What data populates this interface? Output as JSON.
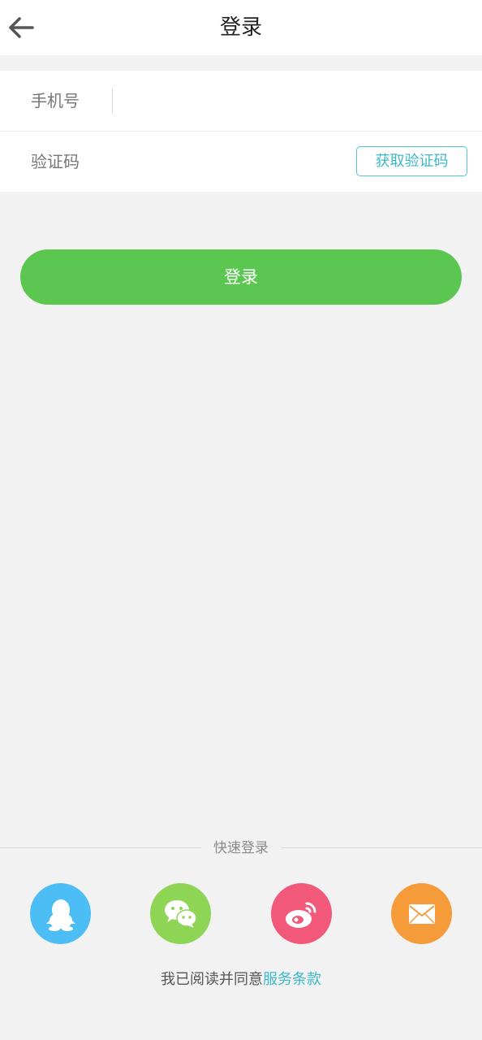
{
  "header": {
    "back_icon": "arrow-left-icon",
    "title": "登录"
  },
  "form": {
    "phone_label": "手机号",
    "phone_value": "",
    "code_label": "验证码",
    "code_value": "",
    "get_code_label": "获取验证码"
  },
  "login_button": "登录",
  "quick_login": {
    "label": "快速登录",
    "providers": [
      {
        "icon": "qq-icon",
        "color": "#4dbef5"
      },
      {
        "icon": "wechat-icon",
        "color": "#8ed455"
      },
      {
        "icon": "weibo-icon",
        "color": "#f2587a"
      },
      {
        "icon": "mail-icon",
        "color": "#f59b3a"
      }
    ]
  },
  "terms": {
    "prefix": "我已阅读并同意",
    "link": "服务条款"
  },
  "colors": {
    "accent": "#5cc750",
    "link": "#3db8c9",
    "background": "#f2f2f2"
  }
}
